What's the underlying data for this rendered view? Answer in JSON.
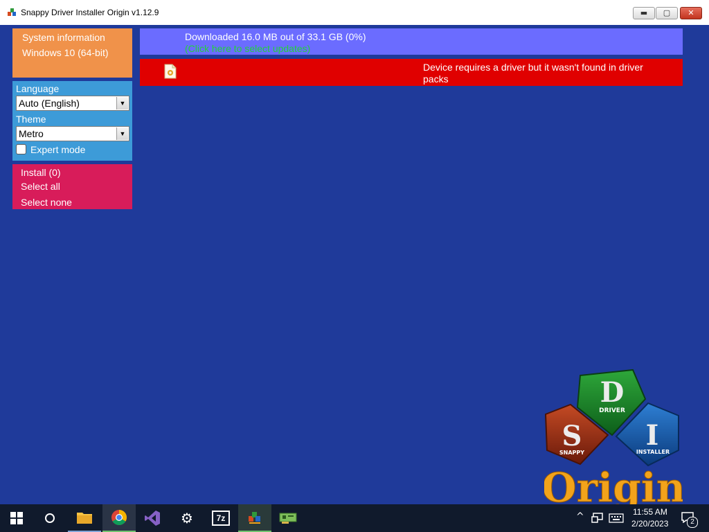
{
  "window": {
    "title": "Snappy Driver Installer Origin v1.12.9",
    "controls": {
      "minimize": "▬",
      "maximize": "▢",
      "close": "✕"
    }
  },
  "sidebar": {
    "system": {
      "label": "System information",
      "os": "Windows 10 (64-bit)"
    },
    "language": {
      "label": "Language",
      "value": "Auto (English)"
    },
    "theme": {
      "label": "Theme",
      "value": "Metro"
    },
    "expert_mode": {
      "label": "Expert mode",
      "checked": false
    },
    "actions": {
      "install": "Install (0)",
      "select_all": "Select all",
      "select_none": "Select none"
    }
  },
  "main": {
    "download_status": "Downloaded 16.0 MB out of 33.1 GB (0%)",
    "update_link": "(Click here to select updates)",
    "device_message": "Device requires a driver but it wasn't found in driver packs"
  },
  "logo": {
    "letters": [
      "S",
      "D",
      "I"
    ],
    "words": [
      "SNAPPY",
      "DRIVER",
      "INSTALLER"
    ],
    "origin": "Origin"
  },
  "taskbar": {
    "time": "11:55 AM",
    "date": "2/20/2023",
    "notifications": "2",
    "sevenzip": "7z"
  },
  "colors": {
    "background": "#1f3a9a",
    "system_panel": "#f0924a",
    "options_panel": "#3d9bd8",
    "install_panel": "#d81c5a",
    "download_banner": "#6b6cff",
    "device_banner": "#e00000",
    "link_green": "#22d33a"
  }
}
